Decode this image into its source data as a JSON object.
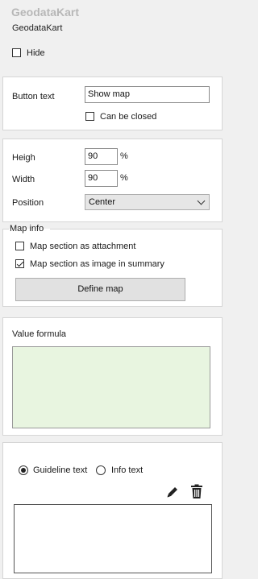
{
  "header": {
    "title": "GeodataKart",
    "subtitle": "GeodataKart"
  },
  "hide": {
    "label": "Hide",
    "checked": false
  },
  "button_panel": {
    "button_text_label": "Button text",
    "button_text_value": "Show map",
    "can_be_closed_label": "Can be closed",
    "can_be_closed_checked": false
  },
  "size_panel": {
    "height_label": "Heigh",
    "height_value": "90",
    "width_label": "Width",
    "width_value": "90",
    "percent": "%",
    "position_label": "Position",
    "position_value": "Center"
  },
  "map_info": {
    "legend": "Map info",
    "attachment_label": "Map section as attachment",
    "attachment_checked": false,
    "image_summary_label": "Map section as image in summary",
    "image_summary_checked": true,
    "define_map_label": "Define map"
  },
  "value_formula": {
    "label": "Value formula",
    "background_color": "#e8f5e0"
  },
  "guideline": {
    "guideline_label": "Guideline text",
    "info_label": "Info text",
    "selected": "Guideline text",
    "edit_icon": "pencil-icon",
    "delete_icon": "trash-icon"
  }
}
